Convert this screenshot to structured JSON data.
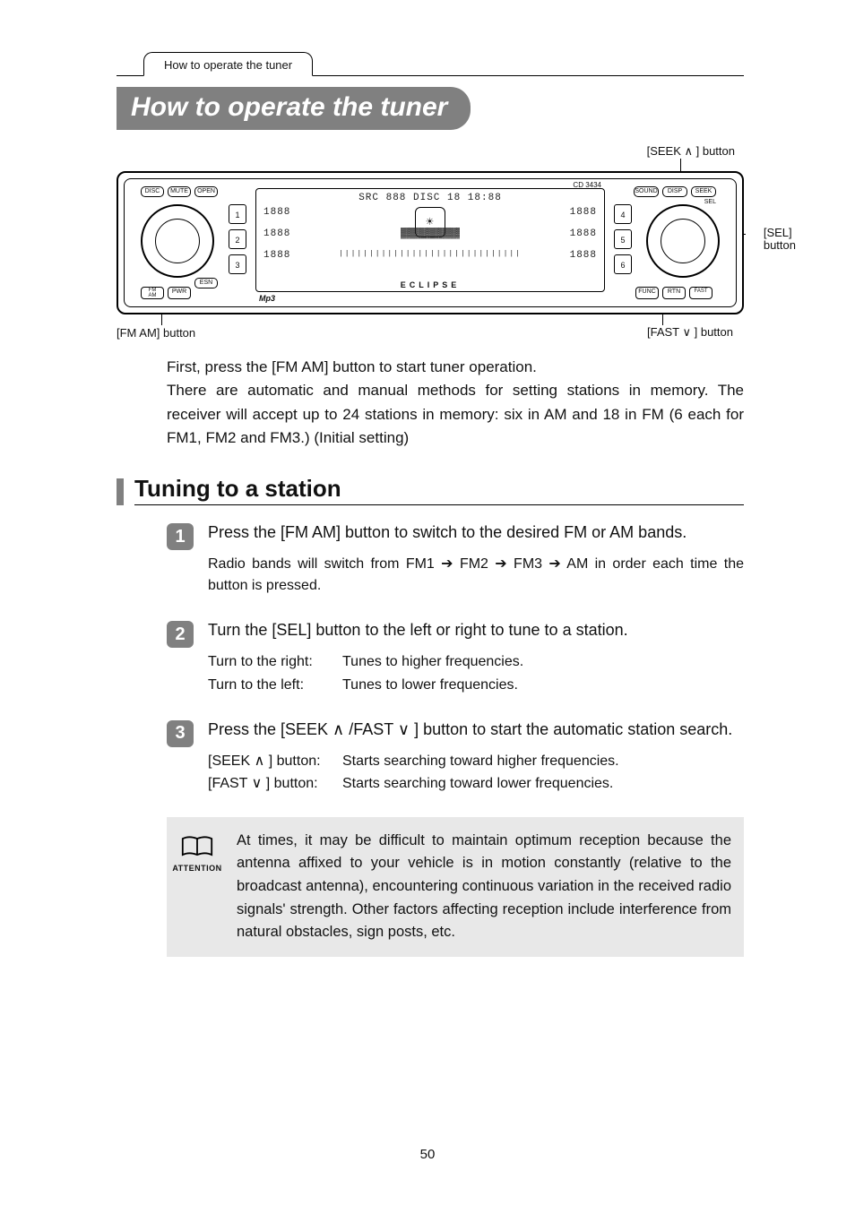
{
  "tab": "How to operate the tuner",
  "title": "How to operate the tuner",
  "callouts": {
    "seek": "[SEEK ∧ ] button",
    "sel": "[SEL]\nbutton",
    "fast": "[FAST ∨ ] button",
    "fmam": "[FM AM] button"
  },
  "device": {
    "buttons": {
      "disc": "DISC",
      "mute": "MUTE",
      "open": "OPEN",
      "sound": "SOUND",
      "disp": "DISP",
      "seek": "SEEK",
      "esn": "ESN",
      "fmam": "FM\nAM",
      "pwr": "PWR",
      "func": "FUNC",
      "rtn": "RTN",
      "fast": "FAST"
    },
    "sel_label": "SEL",
    "presets_left": [
      "1",
      "2",
      "3"
    ],
    "presets_right": [
      "4",
      "5",
      "6"
    ],
    "screen": {
      "top": "SRC 888 DISC 18 18:88",
      "r1_l": "1888",
      "r1_r": "1888",
      "r2_l": "1888",
      "r2_r": "1888",
      "r3_l": "1888",
      "r3_r": "1888",
      "eclipse": "ECLIPSE"
    },
    "mp3": "Mp3",
    "model": "CD 3434"
  },
  "intro_l1": "First, press the [FM AM] button to start tuner operation.",
  "intro_l2": "There are automatic and manual methods for setting stations in memory.  The receiver will accept up to 24 stations in memory: six in AM and 18 in FM (6 each for FM1, FM2 and FM3.) (Initial setting)",
  "h2": "Tuning to a station",
  "steps": [
    {
      "n": "1",
      "title": "Press the [FM AM] button to switch to the desired FM or AM bands.",
      "detail": "Radio bands will switch from FM1 ➔ FM2 ➔ FM3 ➔ AM in order each time the button is pressed."
    },
    {
      "n": "2",
      "title": "Turn the [SEL] button to the left or right to tune to a station.",
      "table": [
        {
          "k": "Turn to the right:",
          "v": "Tunes to higher frequencies."
        },
        {
          "k": "Turn to the left:",
          "v": "Tunes to lower frequencies."
        }
      ]
    },
    {
      "n": "3",
      "title": "Press the [SEEK ∧ /FAST ∨ ] button to start the automatic station search.",
      "table": [
        {
          "k": "[SEEK ∧ ] button:",
          "v": "Starts searching toward higher frequencies."
        },
        {
          "k": "[FAST ∨ ] button:",
          "v": "Starts searching toward lower frequencies."
        }
      ]
    }
  ],
  "attention_label": "ATTENTION",
  "attention_text": "At times, it may be difficult to maintain optimum reception because the antenna affixed to your vehicle is in motion constantly (relative to the broadcast antenna), encountering continuous variation in the received radio signals' strength. Other factors affecting reception include interference from natural obstacles, sign posts, etc.",
  "page_number": "50"
}
